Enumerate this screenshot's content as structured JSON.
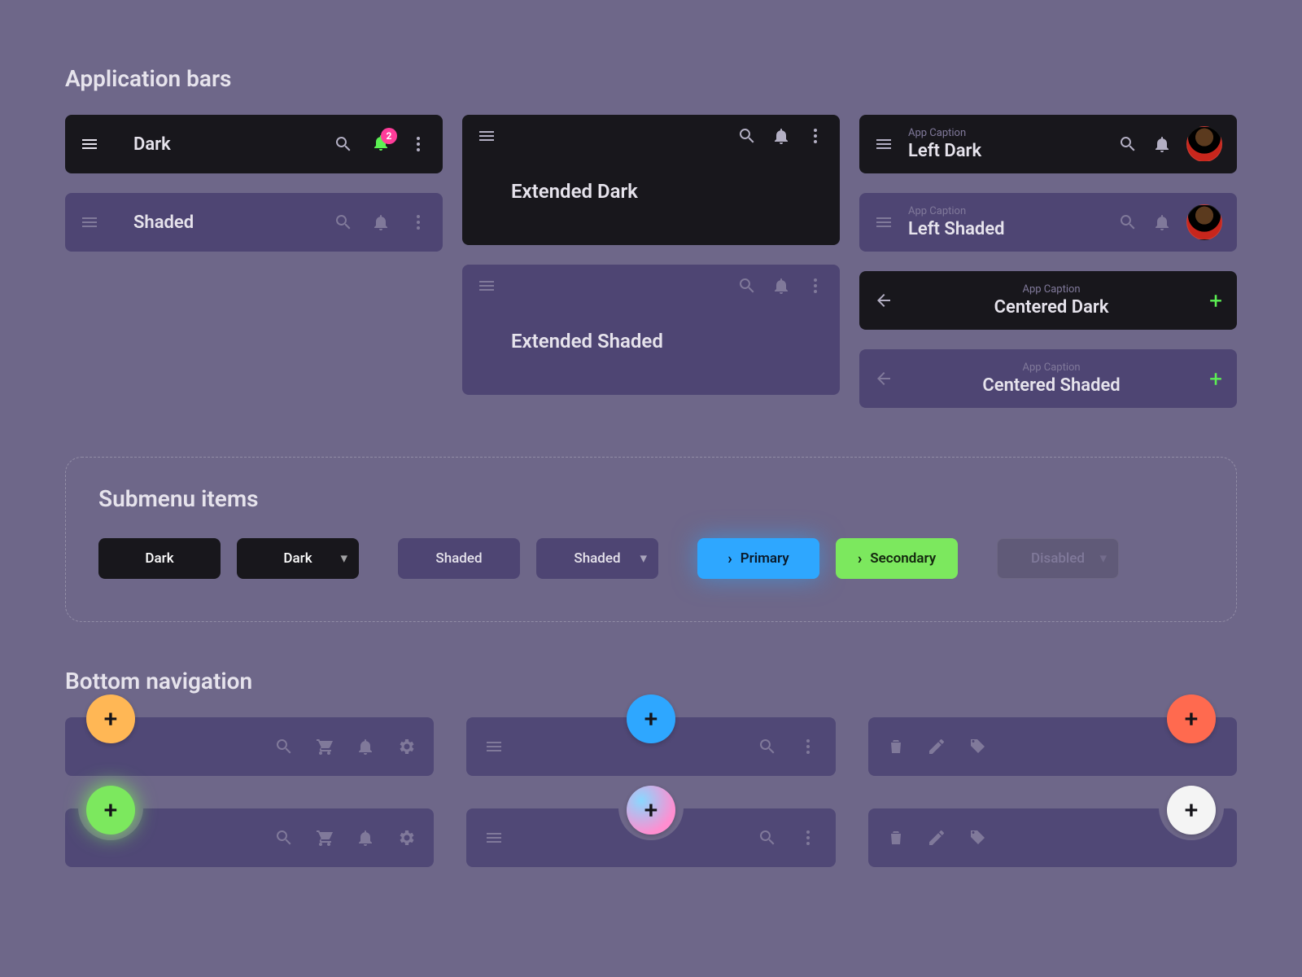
{
  "sections": {
    "appbars": "Application bars",
    "submenu": "Submenu items",
    "bottomnav": "Bottom navigation"
  },
  "appbars": {
    "dark_title": "Dark",
    "shaded_title": "Shaded",
    "notif_count": "2",
    "ext_dark_title": "Extended Dark",
    "ext_shaded_title": "Extended Shaded",
    "caption": "App Caption",
    "left_dark": "Left Dark",
    "left_shaded": "Left Shaded",
    "centered_dark": "Centered Dark",
    "centered_shaded": "Centered Shaded"
  },
  "submenu": {
    "dark": "Dark",
    "shaded": "Shaded",
    "primary": "Primary",
    "secondary": "Secondary",
    "disabled": "Disabled"
  },
  "icons": {
    "menu": "menu-icon",
    "search": "search-icon",
    "bell": "bell-icon",
    "more": "more-vert-icon",
    "back": "arrow-back-icon",
    "add": "add-icon",
    "cart": "cart-icon",
    "gear": "gear-icon",
    "trash": "trash-icon",
    "pencil": "pencil-icon",
    "tag": "tag-icon",
    "chev": "chevron-right-icon",
    "caret": "caret-down-icon"
  },
  "colors": {
    "background": "#6e6789",
    "dark": "#18171c",
    "shaded": "#4e4573",
    "accent_blue": "#2ea7ff",
    "accent_green": "#7ce85e",
    "accent_orange": "#ffb755",
    "accent_red": "#ff6a4f",
    "accent_pink": "#ff3d9a",
    "bell_active": "#5cf053"
  }
}
